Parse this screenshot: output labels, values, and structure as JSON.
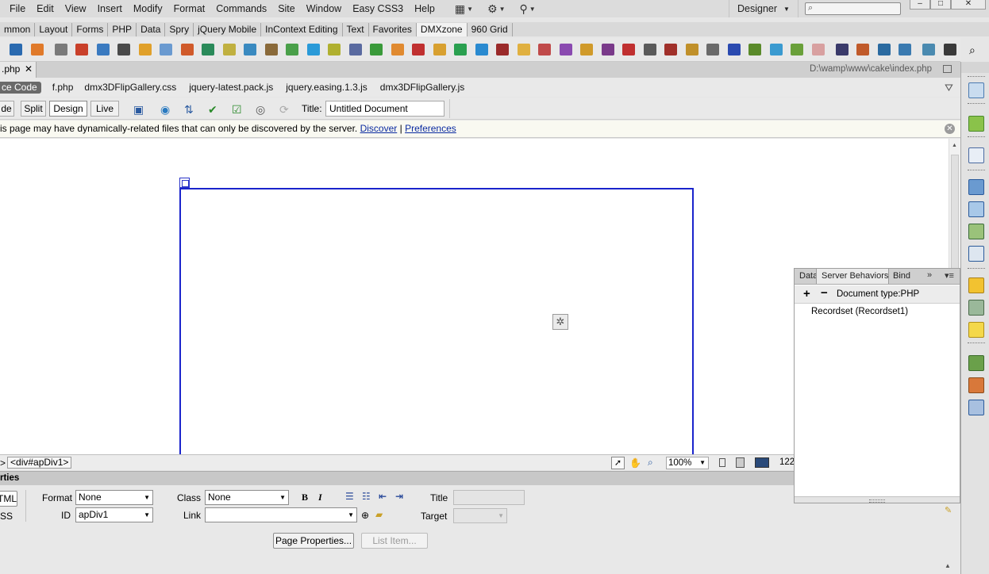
{
  "menu": [
    "File",
    "Edit",
    "View",
    "Insert",
    "Modify",
    "Format",
    "Commands",
    "Site",
    "Window",
    "Easy CSS3",
    "Help"
  ],
  "workspace": "Designer",
  "window_buttons": {
    "minimize": "–",
    "maximize": "□",
    "close": "✕"
  },
  "insert_tabs": [
    "mmon",
    "Layout",
    "Forms",
    "PHP",
    "Data",
    "Spry",
    "jQuery Mobile",
    "InContext Editing",
    "Text",
    "Favorites",
    "DMXzone",
    "960 Grid"
  ],
  "insert_tabs_active": "DMXzone",
  "document": {
    "tab_label": ".php",
    "tab_close": "✕",
    "path": "D:\\wamp\\www\\cake\\index.php"
  },
  "related_files": {
    "source_code": "ce Code",
    "files": [
      "f.php",
      "dmx3DFlipGallery.css",
      "jquery-latest.pack.js",
      "jquery.easing.1.3.js",
      "dmx3DFlipGallery.js"
    ]
  },
  "doc_toolbar": {
    "code_label": "de",
    "split_label": "Split",
    "design_label": "Design",
    "live_label": "Live",
    "title_label": "Title:",
    "title_value": "Untitled Document"
  },
  "infobar": {
    "message": "is page may have dynamically-related files that can only be discovered by the server.",
    "discover": "Discover",
    "separator": "|",
    "preferences": "Preferences",
    "close": "✕"
  },
  "status": {
    "tag_prefix": ">",
    "tag": "<div#apDiv1>",
    "zoom": "100%",
    "window_size": "122"
  },
  "properties": {
    "header": "rties",
    "html_btn": "TML",
    "css_btn": "SS",
    "format_label": "Format",
    "format_value": "None",
    "class_label": "Class",
    "class_value": "None",
    "id_label": "ID",
    "id_value": "apDiv1",
    "link_label": "Link",
    "link_value": "",
    "title_label": "Title",
    "target_label": "Target",
    "bold": "B",
    "italic": "I",
    "page_properties": "Page Properties...",
    "list_item": "List Item..."
  },
  "server_behaviors": {
    "tabs": [
      "Data",
      "Server Behaviors",
      "Bind"
    ],
    "active_tab": "Server Behaviors",
    "add": "+",
    "remove": "−",
    "doctype": "Document type:PHP",
    "items": [
      "Recordset (Recordset1)"
    ]
  },
  "colors": {
    "apdiv_border": "#1a24cc",
    "link": "#0a2aa0"
  }
}
